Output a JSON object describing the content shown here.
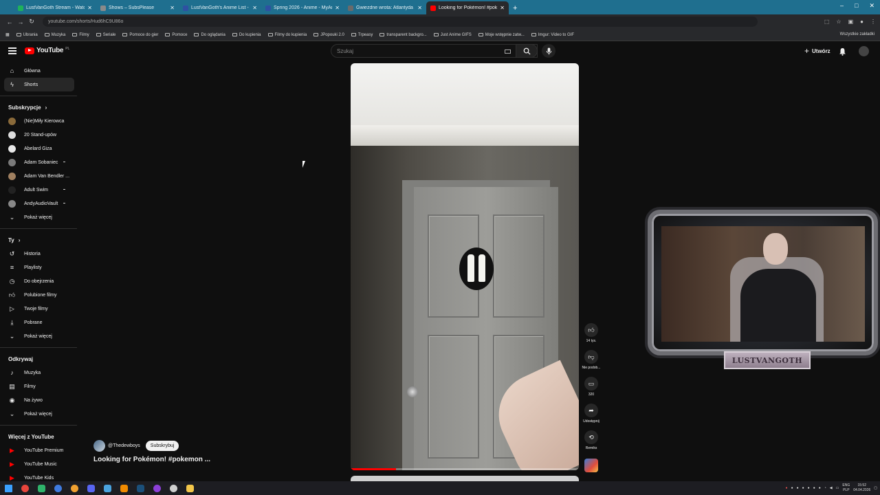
{
  "browser": {
    "tabs": [
      {
        "title": "LustVanGoth Stream - Watch Li",
        "color": "#1fb25a"
      },
      {
        "title": "Shows – SubsPlease",
        "color": "#8a8a8a"
      },
      {
        "title": "LustVanGoth's Anime List - My",
        "color": "#2e51a2"
      },
      {
        "title": "Spring 2026 - Anime - MyAnim",
        "color": "#2e51a2"
      },
      {
        "title": "Gwiezdne wrota: Atlantyda / St",
        "color": "#6a6a6a"
      },
      {
        "title": "Looking for Pokémon! #poke",
        "color": "#ff0000",
        "active": true
      }
    ],
    "new_tab": "+",
    "window_controls": [
      "–",
      "□",
      "✕"
    ],
    "url": "youtube.com/shorts/Hud6hC9U86o",
    "bookmarks": [
      "Ubrania",
      "Muzyka",
      "Filmy",
      "Seriale",
      "Pomoce do gier",
      "Pomoce",
      "Do oglądania",
      "Do kupienia",
      "Filmy do kupienia",
      "JPopouki 2.0",
      "Trpeasy",
      "transparent backgro...",
      "Just Anime GIFS",
      "Moje wstępnie zatw...",
      "Imgur: Video to GIF"
    ],
    "bookmarks_right": "Wszystkie zakładki"
  },
  "youtube": {
    "logo_text": "YouTube",
    "logo_country": "PL",
    "search_placeholder": "Szukaj",
    "create_label": "Utwórz",
    "sidebar": {
      "main": [
        {
          "label": "Główna",
          "icon": "home-icon"
        },
        {
          "label": "Shorts",
          "icon": "shorts-icon",
          "active": true
        }
      ],
      "subs_header": "Subskrypcje",
      "subscriptions": [
        {
          "label": "(Nie)Miły Kierowca",
          "color": "#8a6a3a"
        },
        {
          "label": "20 Stand-upów",
          "color": "#dddddd"
        },
        {
          "label": "Abelard Giza",
          "color": "#e8e8e8"
        },
        {
          "label": "Adam Sobaniec",
          "color": "#7a7a7a",
          "dot": true
        },
        {
          "label": "Adam Van Bendler ...",
          "color": "#a08060"
        },
        {
          "label": "Adult Swim",
          "color": "#222222",
          "dot": true
        },
        {
          "label": "AndyAudioVault",
          "color": "#888888",
          "dot": true
        }
      ],
      "show_more": "Pokaż więcej",
      "you_header": "Ty",
      "you": [
        {
          "label": "Historia",
          "icon": "history-icon"
        },
        {
          "label": "Playlisty",
          "icon": "playlist-icon"
        },
        {
          "label": "Do obejrzenia",
          "icon": "clock-icon"
        },
        {
          "label": "Polubione filmy",
          "icon": "thumb-up-icon"
        },
        {
          "label": "Twoje filmy",
          "icon": "video-icon"
        },
        {
          "label": "Pobrane",
          "icon": "download-icon"
        },
        {
          "label": "Pokaż więcej",
          "icon": "chevron-down-icon"
        }
      ],
      "explore_header": "Odkrywaj",
      "explore": [
        {
          "label": "Muzyka",
          "icon": "music-icon"
        },
        {
          "label": "Filmy",
          "icon": "film-icon"
        },
        {
          "label": "Na żywo",
          "icon": "live-icon"
        },
        {
          "label": "Pokaż więcej",
          "icon": "chevron-down-icon"
        }
      ],
      "more_header": "Więcej z YouTube",
      "more": [
        {
          "label": "YouTube Premium"
        },
        {
          "label": "YouTube Music"
        },
        {
          "label": "YouTube Kids"
        }
      ]
    },
    "short": {
      "channel": "@Thedewboys",
      "subscribe_label": "Subskrybuj",
      "title": "Looking for Pokémon! #pokemon ...",
      "progress": 0.2,
      "actions": [
        {
          "icon": "thumb-up-icon",
          "label": "14 tys."
        },
        {
          "icon": "thumb-down-icon",
          "label": "Nie podob..."
        },
        {
          "icon": "comment-icon",
          "label": "320"
        },
        {
          "icon": "share-icon",
          "label": "Udostępnij"
        },
        {
          "icon": "remix-icon",
          "label": "Remiks"
        }
      ]
    }
  },
  "overlay": {
    "streamer_name": "LUSTVANGOTH"
  },
  "taskbar": {
    "lang_top": "ENG",
    "lang_bottom": "PLP",
    "time": "15:52",
    "date": "04.04.2026"
  }
}
